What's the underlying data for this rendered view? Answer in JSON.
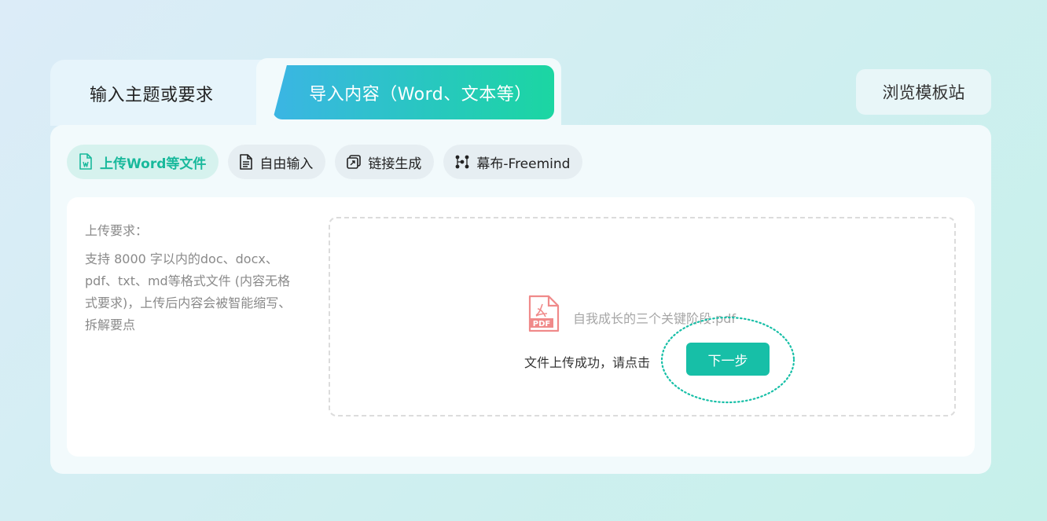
{
  "tabs": {
    "topic_label": "输入主题或要求",
    "import_label": "导入内容（Word、文本等）"
  },
  "browse_label": "浏览模板站",
  "subtabs": [
    {
      "label": "上传Word等文件",
      "icon": "word-file-icon",
      "active": true
    },
    {
      "label": "自由输入",
      "icon": "document-icon",
      "active": false
    },
    {
      "label": "链接生成",
      "icon": "link-icon",
      "active": false
    },
    {
      "label": "幕布-Freemind",
      "icon": "mindmap-icon",
      "active": false
    }
  ],
  "requirements": {
    "title": "上传要求：",
    "text": "支持 8000 字以内的doc、docx、pdf、txt、md等格式文件 (内容无格式要求)，上传后内容会被智能缩写、拆解要点"
  },
  "upload": {
    "file_icon": "pdf-file-icon",
    "file_name": "自我成长的三个关键阶段.pdf",
    "success_text": "文件上传成功，请点击",
    "next_label": "下一步"
  },
  "colors": {
    "accent": "#17bfa7",
    "tab_gradient_start": "#3bb5e4",
    "tab_gradient_end": "#1bd6a2",
    "pdf_icon": "#f08a8a",
    "highlight_ring": "#17bfa7"
  }
}
